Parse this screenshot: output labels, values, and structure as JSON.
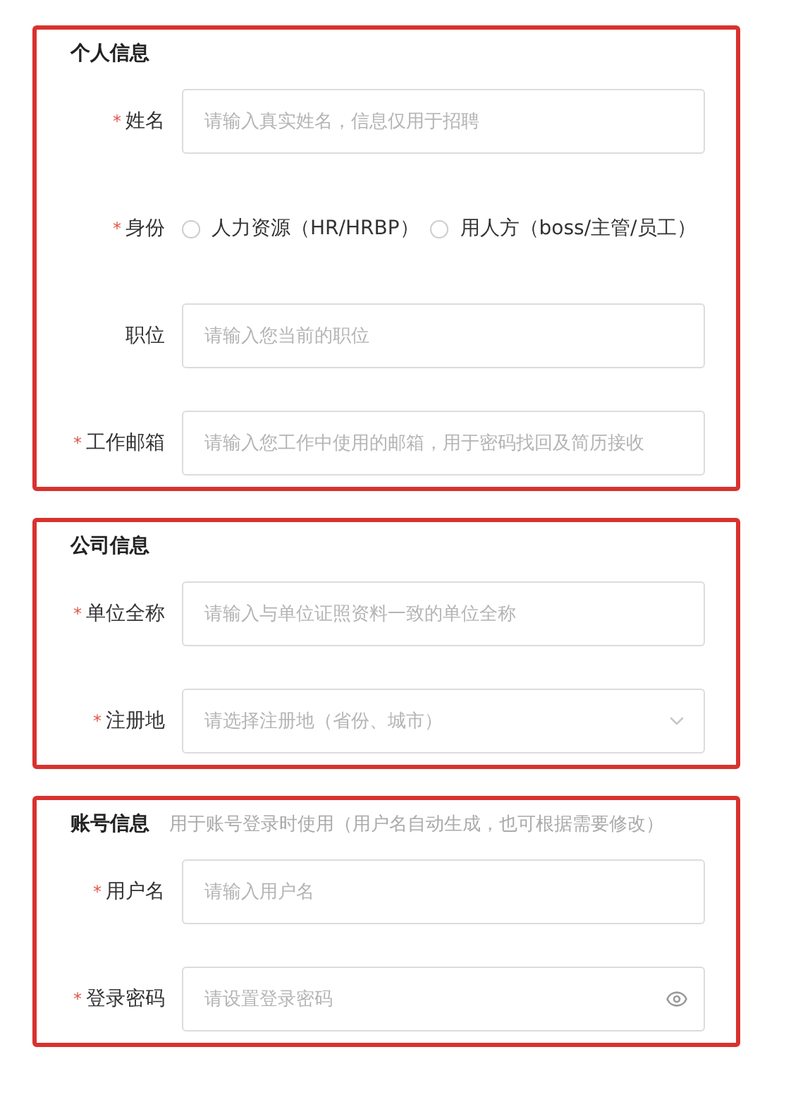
{
  "sections": [
    {
      "title": "个人信息",
      "fields": [
        {
          "kind": "text",
          "label": "姓名",
          "required_mark": "*",
          "placeholder": "请输入真实姓名，信息仅用于招聘"
        },
        {
          "kind": "radio",
          "label": "身份",
          "required_mark": "*",
          "options": [
            {
              "label": "人力资源（HR/HRBP）",
              "selected": false
            },
            {
              "label": "用人方（boss/主管/员工）",
              "selected": false
            }
          ]
        },
        {
          "kind": "text",
          "label": "职位",
          "placeholder": "请输入您当前的职位"
        },
        {
          "kind": "text",
          "label": "工作邮箱",
          "required_mark": "*",
          "placeholder": "请输入您工作中使用的邮箱，用于密码找回及简历接收"
        }
      ]
    },
    {
      "title": "公司信息",
      "fields": [
        {
          "kind": "text",
          "label": "单位全称",
          "required_mark": "*",
          "placeholder": "请输入与单位证照资料一致的单位全称"
        },
        {
          "kind": "select",
          "label": "注册地",
          "required_mark": "*",
          "placeholder": "请选择注册地（省份、城市）"
        }
      ]
    },
    {
      "title": "账号信息",
      "hint": "用于账号登录时使用（用户名自动生成，也可根据需要修改）",
      "fields": [
        {
          "kind": "text",
          "label": "用户名",
          "required_mark": "*",
          "placeholder": "请输入用户名"
        },
        {
          "kind": "password",
          "label": "登录密码",
          "required_mark": "*",
          "placeholder": "请设置登录密码"
        }
      ]
    }
  ]
}
